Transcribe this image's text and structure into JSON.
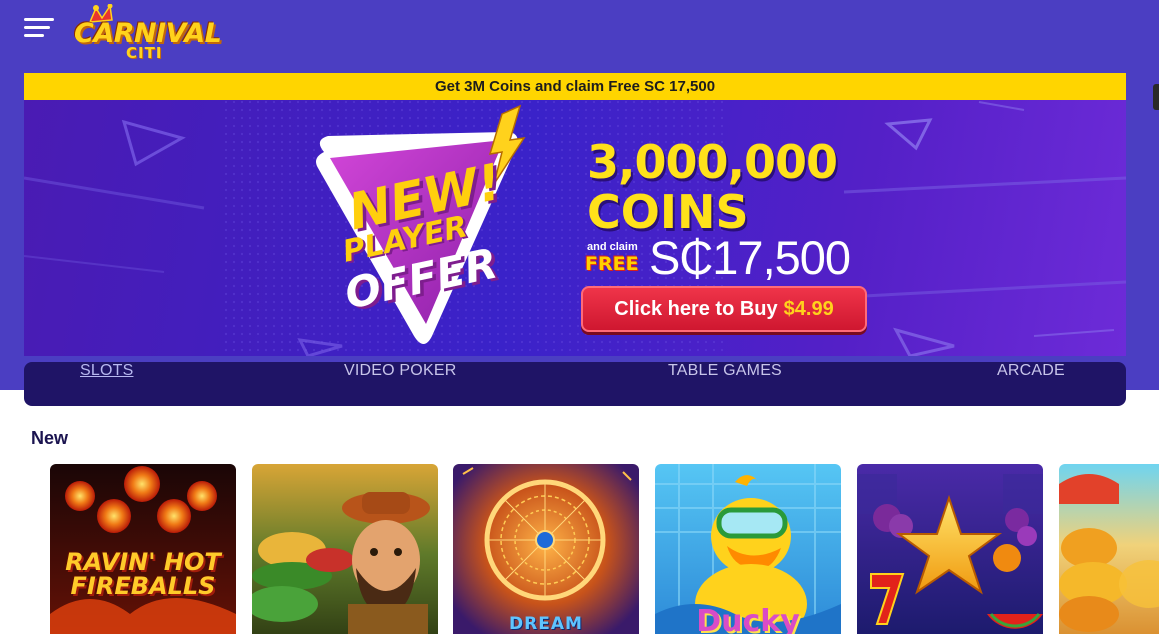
{
  "header": {
    "menu_icon": "hamburger-menu-icon",
    "logo": {
      "line1": "CARNIVAL",
      "line2": "CITI"
    }
  },
  "promo_strip": {
    "text": "Get 3M Coins and claim Free SC 17,500"
  },
  "banner": {
    "badge": {
      "line1": "NEW!",
      "line2": "PLAYER",
      "line3": "OFFER"
    },
    "coins_amount": "3,000,000",
    "coins_word": "COINS",
    "and_claim": "and claim",
    "free_word": "FREE",
    "sc_amount": "S₵17,500",
    "buy_button": {
      "label": "Click here to Buy",
      "price": "$4.99"
    }
  },
  "tabs": [
    {
      "label": "SLOTS",
      "active": true
    },
    {
      "label": "VIDEO POKER",
      "active": false
    },
    {
      "label": "TABLE GAMES",
      "active": false
    },
    {
      "label": "ARCADE",
      "active": false
    }
  ],
  "section": {
    "title": "New"
  },
  "games": [
    {
      "title": "RAVIN' HOT FIREBALLS",
      "art_title_line1": "RAVIN' HOT",
      "art_title_line2": "FIREBALLS"
    },
    {
      "title": ""
    },
    {
      "title": "DREAM",
      "art_title_line1": "DREAM"
    },
    {
      "title": "Ducky",
      "art_title_line1": "Ducky"
    },
    {
      "title": ""
    },
    {
      "title": ""
    }
  ],
  "colors": {
    "top_band": "#4b3ec2",
    "promo_strip": "#ffd500",
    "tabs_bar": "#1f1466",
    "buy_button": "#d81e35",
    "accent_yellow": "#ffe11a"
  }
}
